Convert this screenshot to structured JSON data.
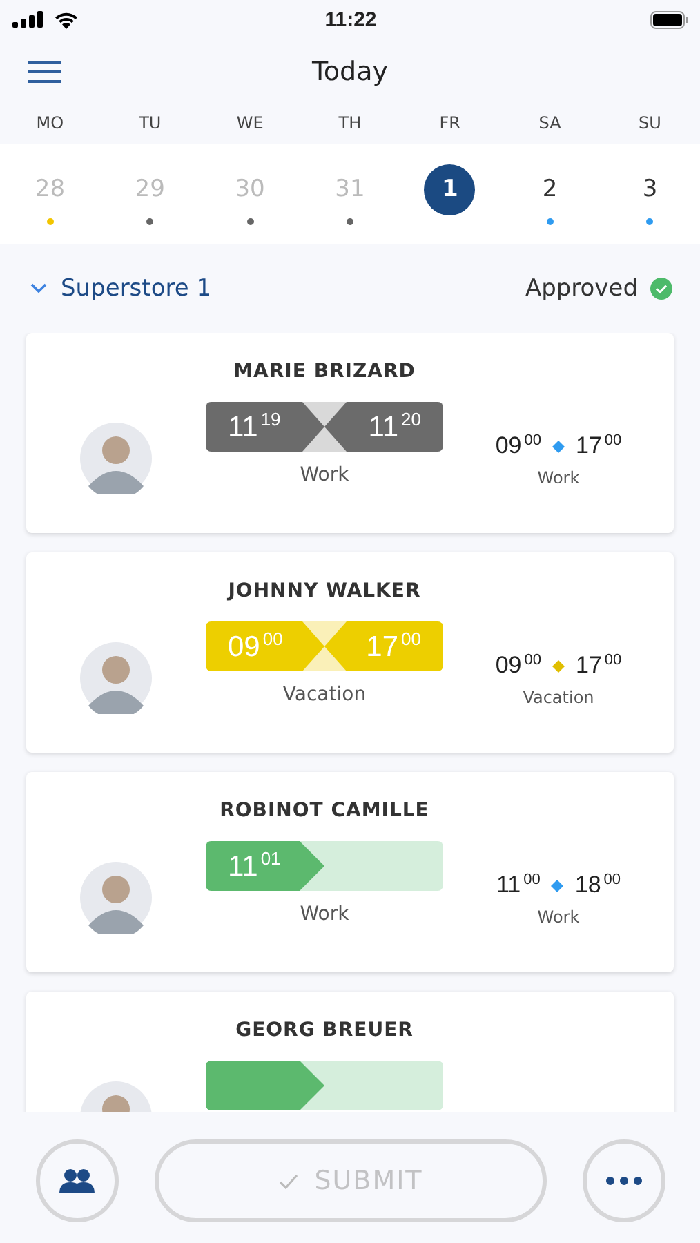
{
  "status_bar": {
    "time": "11:22"
  },
  "header": {
    "title": "Today"
  },
  "days": [
    {
      "weekday": "MO",
      "date": "28",
      "past": true,
      "selected": false,
      "color": "#f2c500"
    },
    {
      "weekday": "TU",
      "date": "29",
      "past": true,
      "selected": false,
      "color": "#666666"
    },
    {
      "weekday": "WE",
      "date": "30",
      "past": true,
      "selected": false,
      "color": "#666666"
    },
    {
      "weekday": "TH",
      "date": "31",
      "past": true,
      "selected": false,
      "color": "#666666"
    },
    {
      "weekday": "FR",
      "date": "1",
      "past": false,
      "selected": true
    },
    {
      "weekday": "SA",
      "date": "2",
      "past": false,
      "selected": false,
      "color": "#2f9bf0"
    },
    {
      "weekday": "SU",
      "date": "3",
      "past": false,
      "selected": false,
      "color": "#2f9bf0"
    }
  ],
  "group": {
    "name": "Superstore 1",
    "expanded": true,
    "status": "Approved",
    "approved": true
  },
  "employees": [
    {
      "name": "MARIE BRIZARD",
      "bar": {
        "kind": "done",
        "start": "11$^{19}$",
        "end": "11$^{20}$"
      },
      "label": "Work",
      "planned": {
        "start": "09$^{00}$",
        "end": "17$^{00}$",
        "color": "#2f9bf0",
        "label": "Work"
      }
    },
    {
      "name": "JOHNNY WALKER",
      "bar": {
        "kind": "vacation",
        "start": "09$^{00}$",
        "end": "17$^{00}$"
      },
      "label": "Vacation",
      "planned": {
        "start": "09$^{00}$",
        "end": "17$^{00}$",
        "color": "#e0be00",
        "label": "Vacation"
      }
    },
    {
      "name": "ROBINOT CAMILLE",
      "bar": {
        "kind": "running",
        "start": "11$^{01}$"
      },
      "label": "Work",
      "planned": {
        "start": "11$^{00}$",
        "end": "18$^{00}$",
        "color": "#2f9bf0",
        "label": "Work"
      }
    },
    {
      "name": "GEORG BREUER",
      "bar": {
        "kind": "running"
      }
    }
  ],
  "actions": {
    "submit": {
      "label": "SUBMIT",
      "disabled": true
    }
  }
}
